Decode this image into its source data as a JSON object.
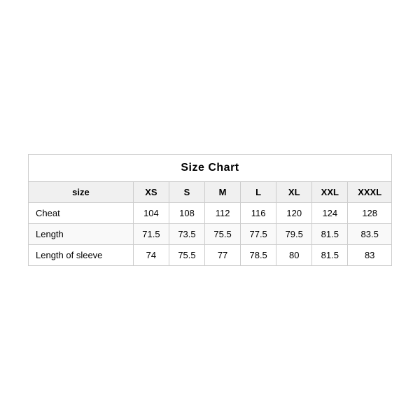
{
  "table": {
    "title": "Size Chart",
    "headers": [
      "size",
      "XS",
      "S",
      "M",
      "L",
      "XL",
      "XXL",
      "XXXL"
    ],
    "rows": [
      {
        "label": "Cheat",
        "values": [
          "104",
          "108",
          "112",
          "116",
          "120",
          "124",
          "128"
        ]
      },
      {
        "label": "Length",
        "values": [
          "71.5",
          "73.5",
          "75.5",
          "77.5",
          "79.5",
          "81.5",
          "83.5"
        ]
      },
      {
        "label": "Length of sleeve",
        "values": [
          "74",
          "75.5",
          "77",
          "78.5",
          "80",
          "81.5",
          "83"
        ]
      }
    ]
  }
}
